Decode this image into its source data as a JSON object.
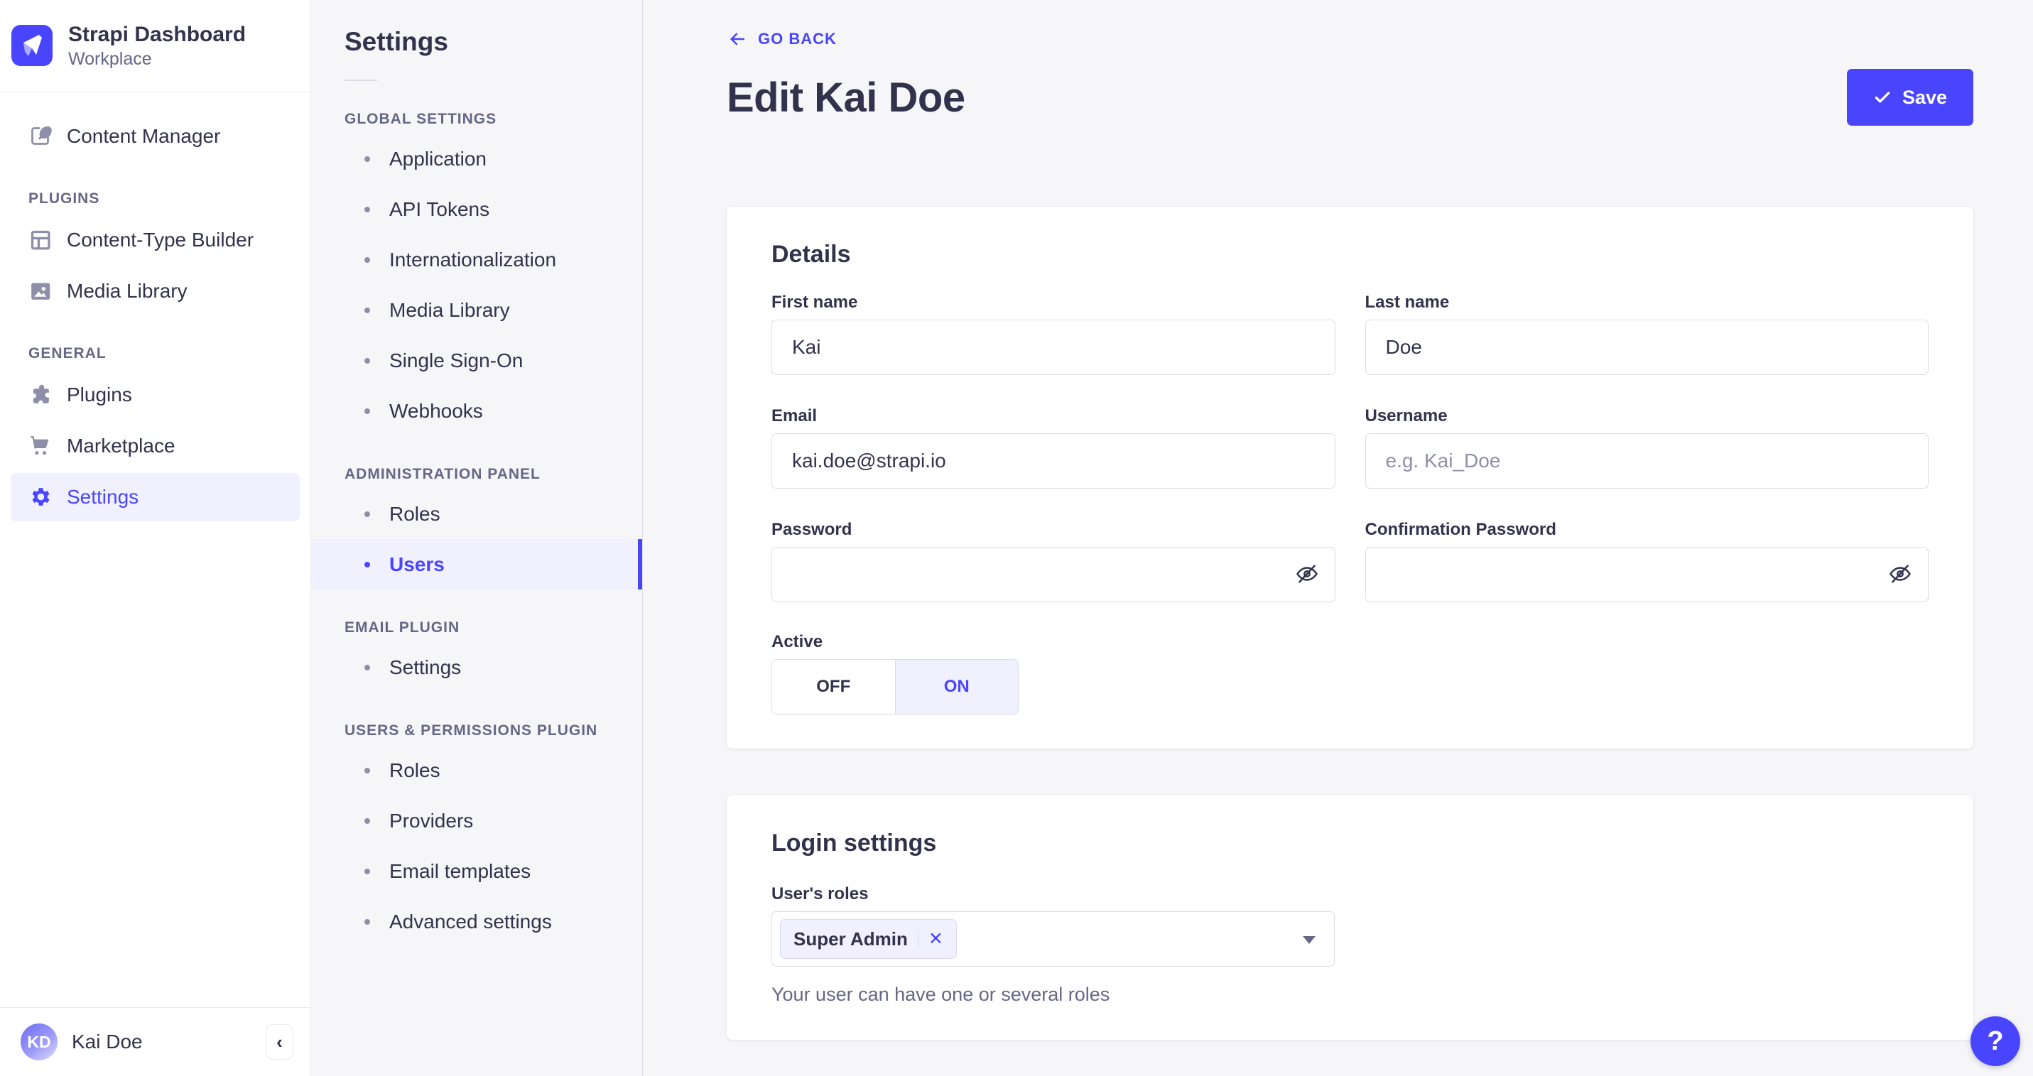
{
  "sidebar": {
    "app_title": "Strapi Dashboard",
    "app_subtitle": "Workplace",
    "sections": {
      "plugins": "PLUGINS",
      "general": "GENERAL"
    },
    "items": [
      {
        "label": "Content Manager",
        "icon": "feather-pen-icon",
        "active": false
      },
      {
        "label": "Content-Type Builder",
        "icon": "layout-grid-icon",
        "active": false
      },
      {
        "label": "Media Library",
        "icon": "picture-icon",
        "active": false
      },
      {
        "label": "Plugins",
        "icon": "puzzle-piece-icon",
        "active": false
      },
      {
        "label": "Marketplace",
        "icon": "shopping-cart-icon",
        "active": false
      },
      {
        "label": "Settings",
        "icon": "gear-icon",
        "active": true
      }
    ],
    "user_name": "Kai Doe",
    "user_initials": "KD"
  },
  "subnav": {
    "title": "Settings",
    "groups": [
      {
        "header": "GLOBAL SETTINGS",
        "items": [
          {
            "label": "Application",
            "active": false
          },
          {
            "label": "API Tokens",
            "active": false
          },
          {
            "label": "Internationalization",
            "active": false
          },
          {
            "label": "Media Library",
            "active": false
          },
          {
            "label": "Single Sign-On",
            "active": false
          },
          {
            "label": "Webhooks",
            "active": false
          }
        ]
      },
      {
        "header": "ADMINISTRATION PANEL",
        "items": [
          {
            "label": "Roles",
            "active": false
          },
          {
            "label": "Users",
            "active": true
          }
        ]
      },
      {
        "header": "EMAIL PLUGIN",
        "items": [
          {
            "label": "Settings",
            "active": false
          }
        ]
      },
      {
        "header": "USERS & PERMISSIONS PLUGIN",
        "items": [
          {
            "label": "Roles",
            "active": false
          },
          {
            "label": "Providers",
            "active": false
          },
          {
            "label": "Email templates",
            "active": false
          },
          {
            "label": "Advanced settings",
            "active": false
          }
        ]
      }
    ]
  },
  "header": {
    "back_label": "GO BACK",
    "title": "Edit Kai Doe",
    "save_label": "Save"
  },
  "details": {
    "card_title": "Details",
    "first_name": {
      "label": "First name",
      "value": "Kai"
    },
    "last_name": {
      "label": "Last name",
      "value": "Doe"
    },
    "email": {
      "label": "Email",
      "value": "kai.doe@strapi.io"
    },
    "username": {
      "label": "Username",
      "value": "",
      "placeholder": "e.g. Kai_Doe"
    },
    "password": {
      "label": "Password",
      "value": ""
    },
    "confirm_password": {
      "label": "Confirmation Password",
      "value": ""
    },
    "active": {
      "label": "Active",
      "off_label": "OFF",
      "on_label": "ON",
      "value": "ON"
    }
  },
  "login": {
    "card_title": "Login settings",
    "roles_label": "User's roles",
    "role_tag": "Super Admin",
    "remove_role_label": "✕",
    "hint": "Your user can have one or several roles"
  },
  "help": {
    "label": "?"
  },
  "colors": {
    "primary": "#4945ff",
    "primary_light": "#f0f0ff",
    "text_dark": "#32324d",
    "text_muted": "#666687",
    "icon_gray": "#8e8ea9",
    "border": "#dcdce4",
    "page_bg": "#f6f6f9"
  }
}
